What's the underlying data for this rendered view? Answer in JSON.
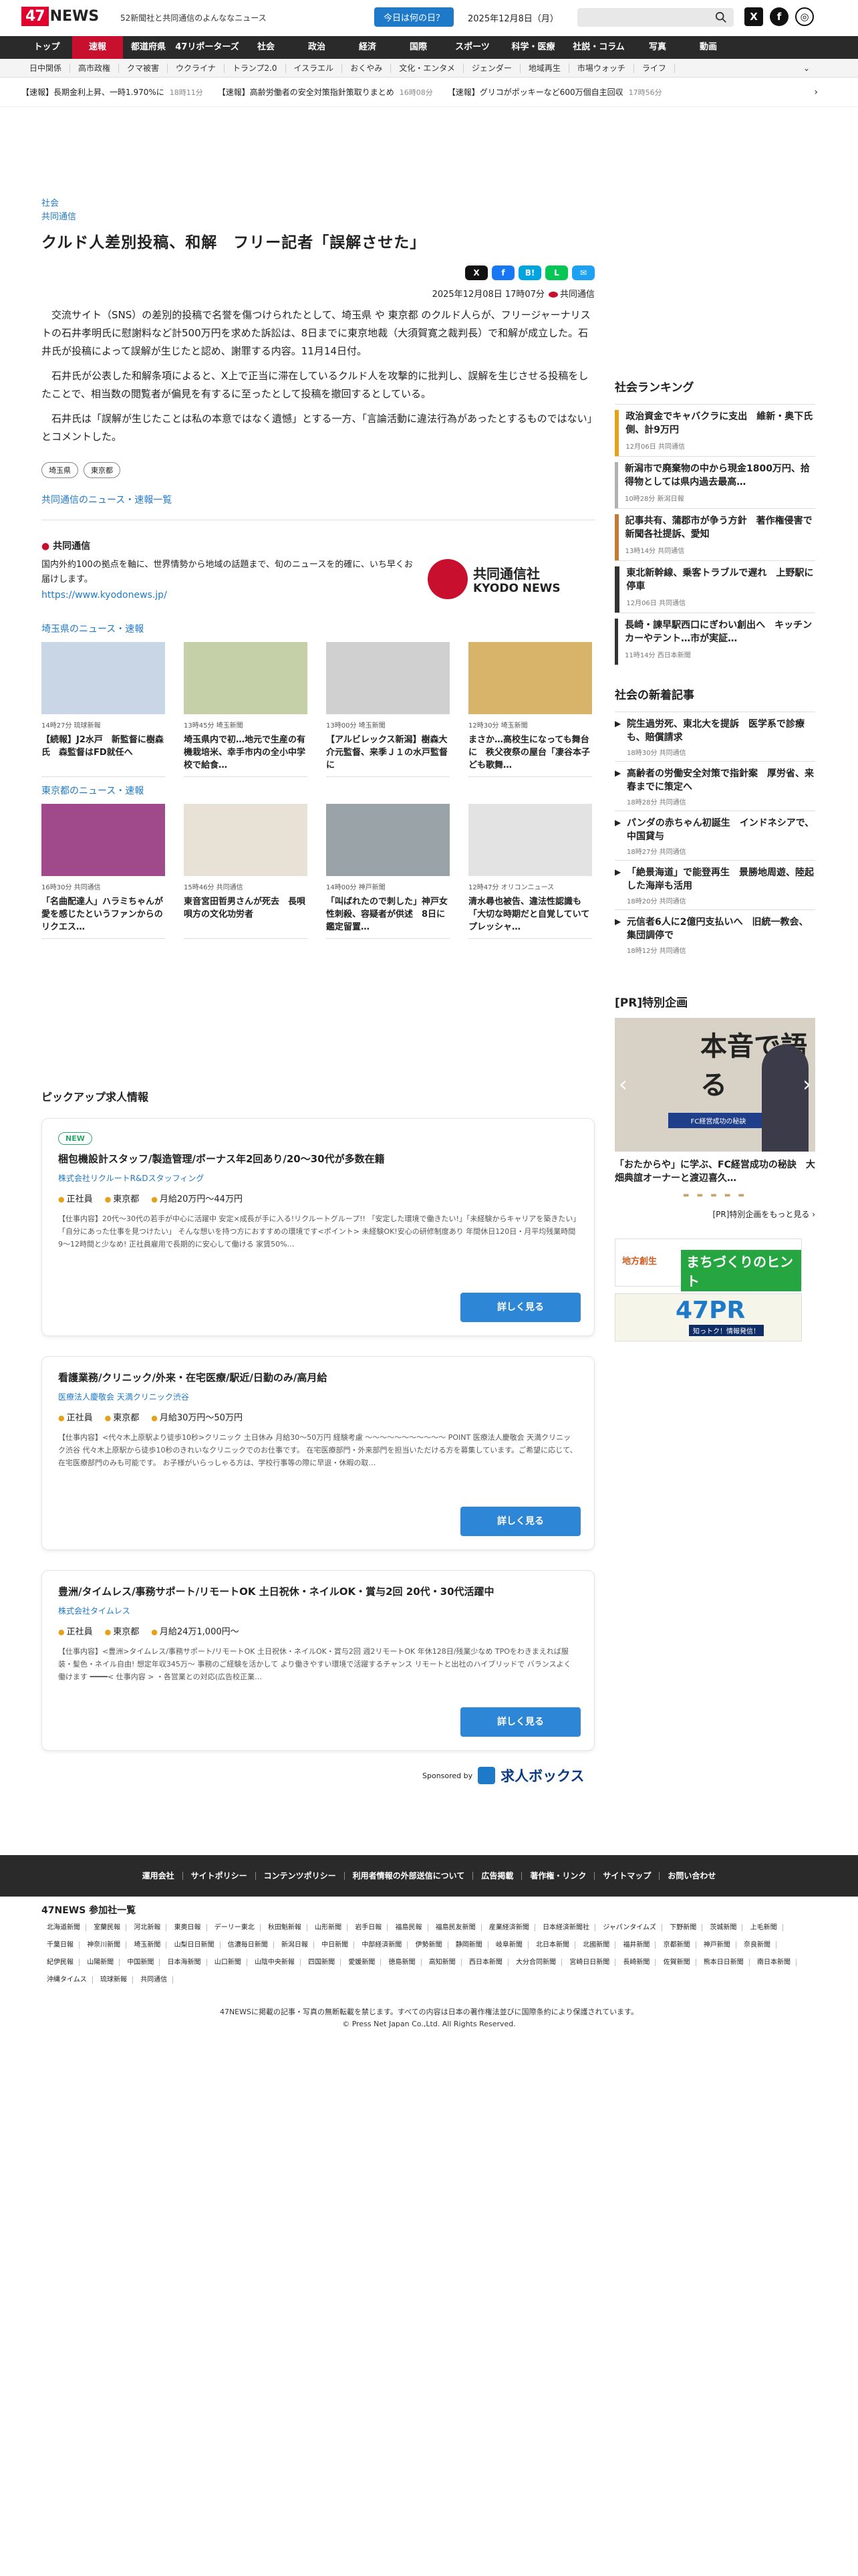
{
  "header": {
    "logo_num": "47",
    "logo_news": "NEWS",
    "tagline": "52新聞社と共同通信のよんななニュース",
    "today_btn": "今日は何の日？",
    "date": "2025年12月8日（月）",
    "social_x": "X",
    "social_fb": "f",
    "social_globe": "◎"
  },
  "nav": {
    "main": [
      "トップ",
      "速報",
      "都道府県",
      "47リポーターズ",
      "社会",
      "政治",
      "経済",
      "国際",
      "スポーツ",
      "科学・医療",
      "社説・コラム",
      "写真",
      "動画"
    ],
    "sub": [
      "日中関係",
      "高市政権",
      "クマ被害",
      "ウクライナ",
      "トランプ2.0",
      "イスラエル",
      "おくやみ",
      "文化・エンタメ",
      "ジェンダー",
      "地域再生",
      "市場ウォッチ",
      "ライフ"
    ],
    "more": "⌄"
  },
  "breaking": [
    {
      "text": "【速報】長期金利上昇、一時1.970%に",
      "time": "18時11分"
    },
    {
      "text": "【速報】高齢労働者の安全対策指針策取りまとめ",
      "time": "16時08分"
    },
    {
      "text": "【速報】グリコがポッキーなど600万個自主回収",
      "time": "17時56分"
    }
  ],
  "breaking_arrow": "›",
  "article": {
    "category": "社会",
    "source": "共同通信",
    "title": "クルド人差別投稿、和解　フリー記者「誤解させた」",
    "share": [
      "X",
      "f",
      "B!",
      "L",
      "✉"
    ],
    "datetime": "2025年12月08日 17時07分",
    "byline": "共同通信",
    "paragraphs": [
      "交流サイト（SNS）の差別的投稿で名誉を傷つけられたとして、埼玉県 や 東京都 のクルド人らが、フリージャーナリストの石井孝明氏に慰謝料など計500万円を求めた訴訟は、8日までに東京地裁（大須賀寛之裁判長）で和解が成立した。石井氏が投稿によって誤解が生じたと認め、謝罪する内容。11月14日付。",
      "石井氏が公表した和解条項によると、X上で正当に滞在しているクルド人を攻撃的に批判し、誤解を生じさせる投稿をしたことで、相当数の閲覧者が偏見を有するに至ったとして投稿を撤回するとしている。",
      "石井氏は「誤解が生じたことは私の本意ではなく遺憾」とする一方、「言論活動に違法行為があったとするものではない」とコメントした。"
    ],
    "tags": [
      "埼玉県",
      "東京都"
    ],
    "more_link": "共同通信のニュース・速報一覧",
    "kyodo_label": "共同通信",
    "kyodo_desc": "国内外約100の拠点を軸に、世界情勢から地域の話題まで、旬のニュースを的確に、いち早くお届けします。",
    "kyodo_url": "https://www.kyodonews.jp/",
    "kyodo_logo_ja": "共同通信社",
    "kyodo_logo_en": "KYODO NEWS"
  },
  "saitama": {
    "heading": "埼玉県のニュース・速報",
    "items": [
      {
        "meta": "14時27分 琉球新報",
        "title": "【続報】J2水戸　新監督に樹森氏　森監督はFD就任へ"
      },
      {
        "meta": "13時45分 埼玉新聞",
        "title": "埼玉県内で初…地元で生産の有機栽培米、幸手市内の全小中学校で給食…"
      },
      {
        "meta": "13時00分 埼玉新聞",
        "title": "【アルビレックス新潟】樹森大介元監督、来季Ｊ１の水戸監督に"
      },
      {
        "meta": "12時30分 埼玉新聞",
        "title": "まさか…高校生になっても舞台に　秩父夜祭の屋台「凄谷本子ども歌舞…"
      }
    ]
  },
  "tokyo": {
    "heading": "東京都のニュース・速報",
    "items": [
      {
        "meta": "16時30分 共同通信",
        "title": "「名曲配達人」ハラミちゃんが愛を感じたというファンからのリクエス…"
      },
      {
        "meta": "15時46分 共同通信",
        "title": "東音宮田哲男さんが死去　長唄唄方の文化功労者"
      },
      {
        "meta": "14時00分 神戸新聞",
        "title": "「叫ばれたので刺した」神戸女性刺殺、容疑者が供述　8日に鑑定留置…"
      },
      {
        "meta": "12時47分 オリコンニュース",
        "title": "清水尋也被告、違法性認識も「大切な時期だと自覚していてプレッシャ…"
      }
    ]
  },
  "jobs": {
    "heading": "ピックアップ求人情報",
    "items": [
      {
        "badge": "NEW",
        "title": "梱包機設計スタッフ/製造管理/ボーナス年2回あり/20〜30代が多数在籍",
        "company": "株式会社リクルートR&Dスタッフィング",
        "type": "正社員",
        "place": "東京都",
        "salary": "月給20万円〜44万円",
        "desc": "【仕事内容】20代〜30代の若手が中心に活躍中 安定×成長が手に入る!リクルートグループ!! 「安定した環境で働きたい!」「未経験からキャリアを築きたい」「自分にあった仕事を見つけたい」 そんな想いを持つ方におすすめの環境です<ポイント> 未経験OK!安心の研修制度あり 年間休日120日・月平均残業時間9〜12時間と少なめ! 正社員雇用で長期的に安心して働ける 家賃50%…",
        "button": "詳しく見る"
      },
      {
        "badge": "",
        "title": "看護業務/クリニック/外来・在宅医療/駅近/日勤のみ/高月給",
        "company": "医療法人慶敬会 天満クリニック渋谷",
        "type": "正社員",
        "place": "東京都",
        "salary": "月給30万円〜50万円",
        "desc": "【仕事内容】<代々木上原駅より徒歩10秒>クリニック 土日休み 月給30〜50万円 経験考慮 ～～～～～～～～～～～ POINT 医療法人慶敬会 天満クリニック渋谷 代々木上原駅から徒歩10秒のきれいなクリニックでのお仕事です。 在宅医療部門・外来部門を担当いただける方を募集しています。ご希望に応じて、在宅医療部門のみも可能です。 お子様がいらっしゃる方は、学校行事等の際に早退・休暇の取…",
        "button": "詳しく見る"
      },
      {
        "badge": "",
        "title": "豊洲/タイムレス/事務サポート/リモートOK 土日祝休・ネイルOK・賞与2回 20代・30代活躍中",
        "company": "株式会社タイムレス",
        "type": "正社員",
        "place": "東京都",
        "salary": "月給24万1,000円〜",
        "desc": "【仕事内容】<豊洲>タイムレス/事務サポート/リモートOK 土日祝休・ネイルOK・賞与2回 週2リモートOK 年休128日/残業少なめ TPOをわきまえれば服装・髪色・ネイル自由! 想定年収345万〜 事務のご経験を活かして より働きやすい環境で活躍するチャンス リモートと出社のハイブリッドで バランスよく働けます ━━━━< 仕事内容 > ・各営業との対応(広告校正業…",
        "button": "詳しく見る"
      }
    ],
    "sponsored": "Sponsored by",
    "sponsor_name": "求人ボックス"
  },
  "sidebar": {
    "ranking_title": "社会ランキング",
    "ranking": [
      {
        "title": "政治資金でキャバクラに支出　維新・奥下氏側、計9万円",
        "meta": "12月06日 共同通信",
        "color": "#e5a11a"
      },
      {
        "title": "新潟市で廃棄物の中から現金1800万円、拾得物としては県内過去最高…",
        "meta": "10時28分 新潟日報",
        "color": "#b0b0b0"
      },
      {
        "title": "記事共有、蒲郡市が争う方針　著作権侵害で新聞各社提訴、愛知",
        "meta": "13時14分 共同通信",
        "color": "#c47a35"
      },
      {
        "title": "東北新幹線、乗客トラブルで遅れ　上野駅に停車",
        "meta": "12月06日 共同通信",
        "color": "#333333"
      },
      {
        "title": "長崎・諫早駅西口にぎわい創出へ　キッチンカーやテント…市が実証…",
        "meta": "11時14分 西日本新聞",
        "color": "#333333"
      }
    ],
    "new_title": "社会の新着記事",
    "new": [
      {
        "title": "院生過労死、東北大を提訴　医学系で診療も、賠償請求",
        "meta": "18時30分 共同通信"
      },
      {
        "title": "高齢者の労働安全対策で指針案　厚労省、来春までに策定へ",
        "meta": "18時28分 共同通信"
      },
      {
        "title": "パンダの赤ちゃん初誕生　インドネシアで、中国貸与",
        "meta": "18時27分 共同通信"
      },
      {
        "title": "「絶景海道」で能登再生　景勝地周遊、陸起した海岸も活用",
        "meta": "18時20分 共同通信"
      },
      {
        "title": "元信者6人に2億円支払いへ　旧統一教会、集団調停で",
        "meta": "18時12分 共同通信"
      }
    ],
    "pr_title": "[PR]特別企画",
    "pr_big": "本音で語る",
    "pr_sub": "FC経営成功の秘訣",
    "pr_arrow_l": "‹",
    "pr_arrow_r": "›",
    "pr_caption": "「おたからや」に学ぶ、FC経営成功の秘訣　大畑典誼オーナーと渡辺喜久…",
    "pr_dots": "▬ ▬ ▬ ▬ ▬",
    "pr_list": "[PR]特別企画をもっと見る ›",
    "ad1_a": "まちづくりのヒント",
    "ad1_b": "地方創生",
    "ad2_a": "47PR",
    "ad2_b": "知っトク！情報発信！"
  },
  "footer": {
    "links": [
      "運用会社",
      "サイトポリシー",
      "コンテンツポリシー",
      "利用者情報の外部送信について",
      "広告掲載",
      "著作権・リンク",
      "サイトマップ",
      "お問い合わせ"
    ],
    "members_title": "47NEWS 参加社一覧",
    "members": [
      "北海道新聞",
      "室蘭民報",
      "河北新報",
      "東奥日報",
      "デーリー東北",
      "秋田魁新報",
      "山形新聞",
      "岩手日報",
      "福島民報",
      "福島民友新聞",
      "産業経済新聞",
      "日本経済新聞社",
      "ジャパンタイムズ",
      "下野新聞",
      "茨城新聞",
      "上毛新聞",
      "千葉日報",
      "神奈川新聞",
      "埼玉新聞",
      "山梨日日新聞",
      "信濃毎日新聞",
      "新潟日報",
      "中日新聞",
      "中部経済新聞",
      "伊勢新聞",
      "静岡新聞",
      "岐阜新聞",
      "北日本新聞",
      "北國新聞",
      "福井新聞",
      "京都新聞",
      "神戸新聞",
      "奈良新聞",
      "紀伊民報",
      "山陽新聞",
      "中国新聞",
      "日本海新聞",
      "山口新聞",
      "山陰中央新報",
      "四国新聞",
      "愛媛新聞",
      "徳島新聞",
      "高知新聞",
      "西日本新聞",
      "大分合同新聞",
      "宮崎日日新聞",
      "長崎新聞",
      "佐賀新聞",
      "熊本日日新聞",
      "南日本新聞",
      "沖縄タイムス",
      "琉球新報",
      "共同通信"
    ],
    "copy1": "47NEWSに掲載の記事・写真の無断転載を禁じます。すべての内容は日本の著作権法並びに国際条約により保護されています。",
    "copy2": "© Press Net Japan Co.,Ltd. All Rights Reserved."
  }
}
